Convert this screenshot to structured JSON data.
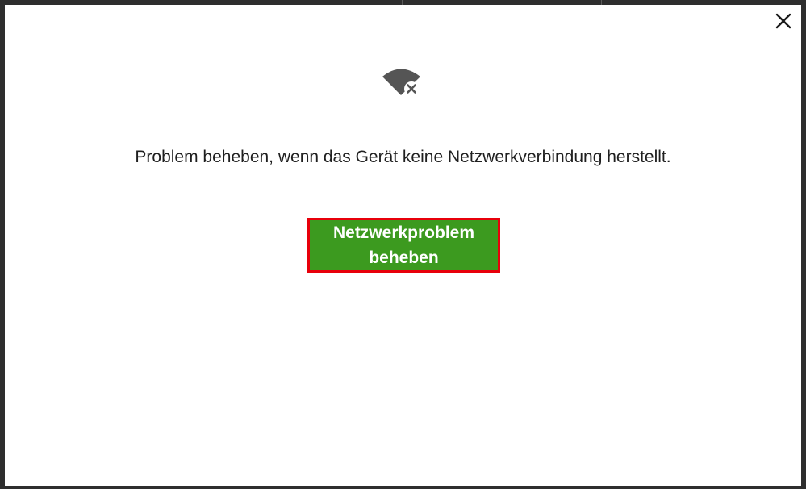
{
  "dialog": {
    "close_icon": "close-icon",
    "status_icon": "wifi-disconnected-icon",
    "message": "Problem beheben, wenn das Gerät keine Netzwerkverbindung herstellt.",
    "fix_button_label": "Netzwerkproblem beheben"
  },
  "colors": {
    "button_background": "#3c9a1f",
    "button_highlight_border": "#e8000b",
    "icon": "#555555"
  }
}
